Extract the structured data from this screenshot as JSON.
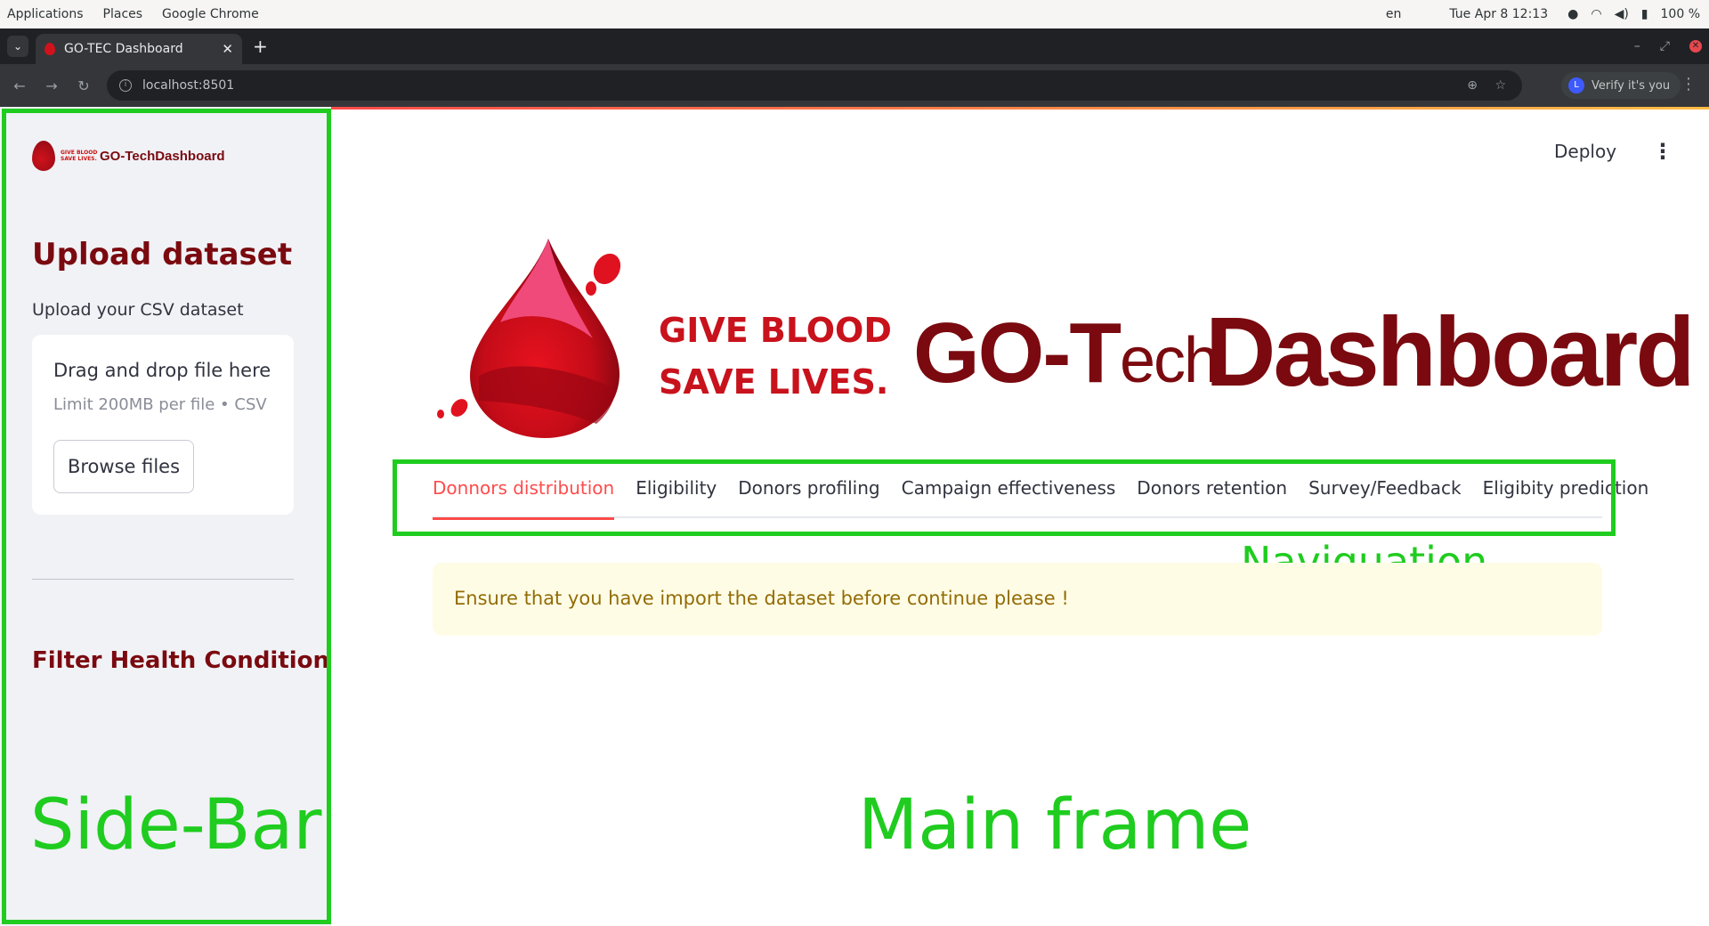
{
  "system_bar": {
    "applications": "Applications",
    "places": "Places",
    "app_name": "Google Chrome",
    "lang": "en",
    "clock": "Tue Apr 8  12:13",
    "battery": "100 %"
  },
  "browser": {
    "tab_title": "GO-TEC Dashboard",
    "url": "localhost:8501",
    "profile_label": "Verify it's you",
    "profile_initial": "L"
  },
  "sidebar": {
    "logo_small_text": "GIVE BLOOD SAVE LIVES.",
    "logo_brand": "GO-TechDashboard",
    "upload_title": "Upload dataset",
    "upload_label": "Upload your CSV dataset",
    "dropzone_title": "Drag and drop file here",
    "dropzone_limit": "Limit 200MB per file • CSV",
    "browse_button": "Browse files",
    "filter_title": "Filter Health Condition",
    "annotation": "Side-Bar"
  },
  "header": {
    "deploy": "Deploy"
  },
  "hero": {
    "give_blood_line1": "GIVE BLOOD",
    "give_blood_line2": "SAVE LIVES.",
    "go_tech": "GO-T",
    "go_tech_small": "ech",
    "dashboard": "Dashboard"
  },
  "navigation": {
    "tabs": [
      {
        "label": "Donnors distribution",
        "active": true
      },
      {
        "label": "Eligibility",
        "active": false
      },
      {
        "label": "Donors profiling",
        "active": false
      },
      {
        "label": "Campaign effectiveness",
        "active": false
      },
      {
        "label": "Donors retention",
        "active": false
      },
      {
        "label": "Survey/Feedback",
        "active": false
      },
      {
        "label": "Eligibity prediction",
        "active": false
      }
    ],
    "annotation": "Naviguation"
  },
  "main": {
    "alert": "Ensure that you have import the dataset before continue please !",
    "annotation": "Main frame"
  },
  "colors": {
    "brand": "#7a0a0f",
    "accent": "#ff4b4b",
    "annotation": "#1fcc1f",
    "alert_bg": "#fffce6",
    "alert_text": "#926c05"
  }
}
